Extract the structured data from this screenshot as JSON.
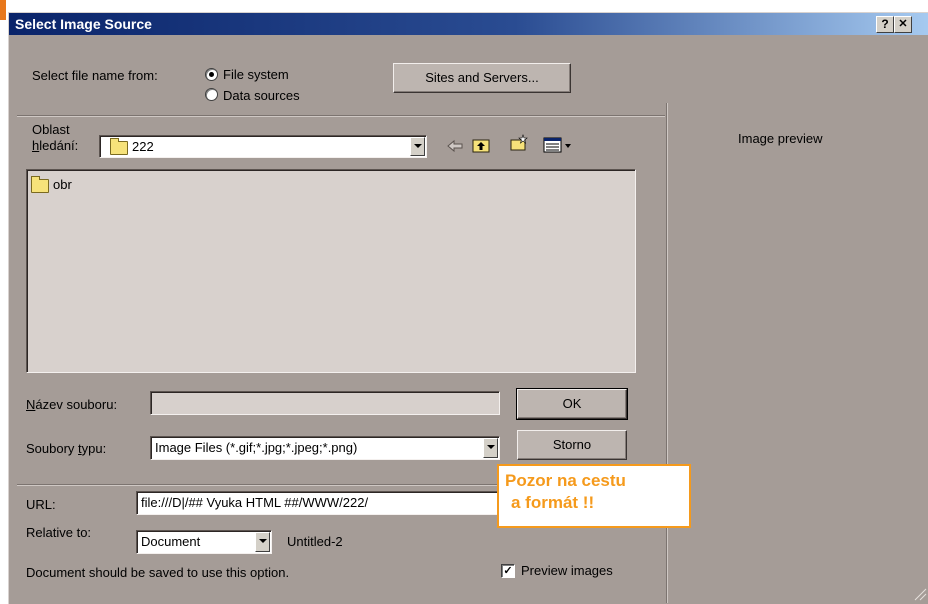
{
  "dialog": {
    "title": "Select Image Source",
    "help_label": "?",
    "close_label": "✕"
  },
  "source": {
    "label": "Select file name from:",
    "options": [
      "File system",
      "Data sources"
    ],
    "selected": "File system",
    "sites_button": "Sites and Servers..."
  },
  "browser": {
    "look_in_label_1": "Oblast",
    "look_in_label_2": "hledání:",
    "current_folder": "222",
    "toolbar_icons": [
      "back-arrow-icon",
      "up-folder-icon",
      "new-folder-icon",
      "view-menu-icon"
    ],
    "items": [
      {
        "name": "obr",
        "type": "folder"
      }
    ]
  },
  "file": {
    "name_label": "Název souboru:",
    "name_value": "",
    "type_label": "Soubory typu:",
    "type_value": "Image Files (*.gif;*.jpg;*.jpeg;*.png)",
    "ok_button": "OK",
    "cancel_button": "Storno"
  },
  "url": {
    "label": "URL:",
    "value": "file:///D|/## Vyuka HTML ##/WWW/222/",
    "relative_label": "Relative to:",
    "relative_value": "Document",
    "document_name": "Untitled-2",
    "save_note": "Document should be saved to use this option."
  },
  "preview": {
    "label": "Image preview",
    "checkbox_label": "Preview images",
    "checked": true
  },
  "annotation": {
    "line1": "Pozor na cestu",
    "line2": "a formát !!"
  },
  "colors": {
    "dialog_bg": "#a59c97",
    "titlebar": "#0a246a",
    "annotation": "#f59a1c"
  }
}
